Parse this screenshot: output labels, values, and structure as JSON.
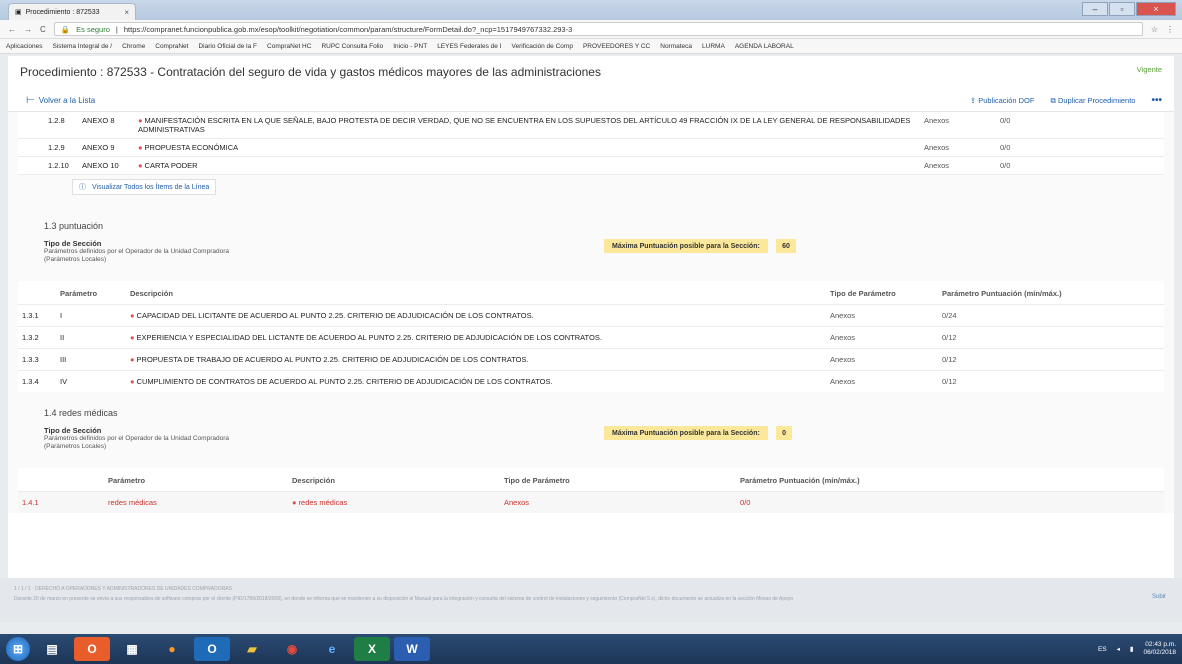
{
  "browser": {
    "tab_title": "Procedimiento : 872533",
    "secure_label": "Es seguro",
    "url": "https://compranet.funcionpublica.gob.mx/esop/toolkit/negotiation/common/param/structure/FormDetail.do?_ncp=1517949767332.293-3",
    "bookmarks": [
      "Aplicaciones",
      "Sistema Integral de /",
      "Chrome",
      "CompraNet",
      "Diario Oficial de la F",
      "CompraNet HC",
      "RUPC Consulta Folio",
      "Inicio - PNT",
      "LEYES Federales de I",
      "Verificación de Comp",
      "PROVEEDORES Y CC",
      "Normateca",
      "LURMA",
      "AGENDA LABORAL"
    ]
  },
  "header": {
    "title": "Procedimiento : 872533 - Contratación del seguro de vida y gastos médicos mayores de las administraciones",
    "status": "Vigente"
  },
  "actions": {
    "back": "Volver a la Lista",
    "publish": "Publicación DOF",
    "duplicate": "Duplicar Procedimiento",
    "more": "•••"
  },
  "items": [
    {
      "num": "1.2.8",
      "anexo": "ANEXO 8",
      "desc": "MANIFESTACIÓN ESCRITA EN LA QUE SEÑALE, BAJO PROTESTA DE DECIR VERDAD, QUE NO SE ENCUENTRA EN LOS SUPUESTOS DEL ARTÍCULO 49 FRACCIÓN IX DE LA LEY GENERAL DE RESPONSABILIDADES ADMINISTRATIVAS",
      "tipo": "Anexos",
      "val": "0/0"
    },
    {
      "num": "1.2.9",
      "anexo": "ANEXO 9",
      "desc": "PROPUESTA ECONÓMICA",
      "tipo": "Anexos",
      "val": "0/0"
    },
    {
      "num": "1.2.10",
      "anexo": "ANEXO 10",
      "desc": "CARTA PODER",
      "tipo": "Anexos",
      "val": "0/0"
    }
  ],
  "view_all": "Visualizar Todos los Ítems de la Línea",
  "section13": {
    "title": "1.3 puntuación",
    "tipo_label": "Tipo de Sección",
    "tipo_desc1": "Parámetros definidos por el Operador de la Unidad Compradora",
    "tipo_desc2": "(Parámetros Locales)",
    "max_label": "Máxima Puntuación posible para la Sección:",
    "max_value": "60",
    "headers": {
      "param": "Parámetro",
      "desc": "Descripción",
      "tipo": "Tipo de Parámetro",
      "punt": "Parámetro Puntuación (mín/máx.)"
    },
    "rows": [
      {
        "num": "1.3.1",
        "param": "I",
        "desc": "CAPACIDAD DEL LICITANTE DE ACUERDO AL PUNTO 2.25. CRITERIO DE ADJUDICACIÓN DE LOS CONTRATOS.",
        "tipo": "Anexos",
        "punt": "0/24"
      },
      {
        "num": "1.3.2",
        "param": "II",
        "desc": "EXPERIENCIA Y ESPECIALIDAD DEL LICTANTE DE ACUERDO AL PUNTO 2.25. CRITERIO DE ADJUDICACIÓN DE LOS CONTRATOS.",
        "tipo": "Anexos",
        "punt": "0/12"
      },
      {
        "num": "1.3.3",
        "param": "III",
        "desc": "PROPUESTA DE TRABAJO DE ACUERDO AL PUNTO 2.25. CRITERIO DE ADJUDICACIÓN DE LOS CONTRATOS.",
        "tipo": "Anexos",
        "punt": "0/12"
      },
      {
        "num": "1.3.4",
        "param": "IV",
        "desc": "CUMPLIMIENTO DE CONTRATOS DE ACUERDO AL PUNTO 2.25. CRITERIO DE ADJUDICACIÓN DE LOS CONTRATOS.",
        "tipo": "Anexos",
        "punt": "0/12"
      }
    ]
  },
  "section14": {
    "title": "1.4 redes médicas",
    "tipo_label": "Tipo de Sección",
    "tipo_desc1": "Parámetros definidos por el Operador de la Unidad Compradora",
    "tipo_desc2": "(Parámetros Locales)",
    "max_label": "Máxima Puntuación posible para la Sección:",
    "max_value": "0",
    "headers": {
      "param": "Parámetro",
      "desc": "Descripción",
      "tipo": "Tipo de Parámetro",
      "punt": "Parámetro Puntuación (mín/máx.)"
    },
    "row": {
      "num": "1.4.1",
      "param": "redes médicas",
      "desc": "redes médicas",
      "tipo": "Anexos",
      "punt": "0/0"
    }
  },
  "footer": {
    "line1": "1 / 1 / 1 · DERECHO A OPERADORES Y ADMINISTRADORES DE UNIDADES COMPRADORAS",
    "line2": "Durante 20 de marzo en presente se envía a sus responsables de software compras por el cliente (PID/1789/2018/2009), en donde se informa que se mantienen a su disposición el Manual para la integración y consulta del sistema de control de instalaciones y seguimiento (CompraNet 5.x), dicho documento se actualiza en la sección Mesas de Apoyo",
    "top_link": "Subir"
  },
  "taskbar": {
    "lang": "ES",
    "time": "02:43 p.m.",
    "date": "06/02/2018"
  }
}
